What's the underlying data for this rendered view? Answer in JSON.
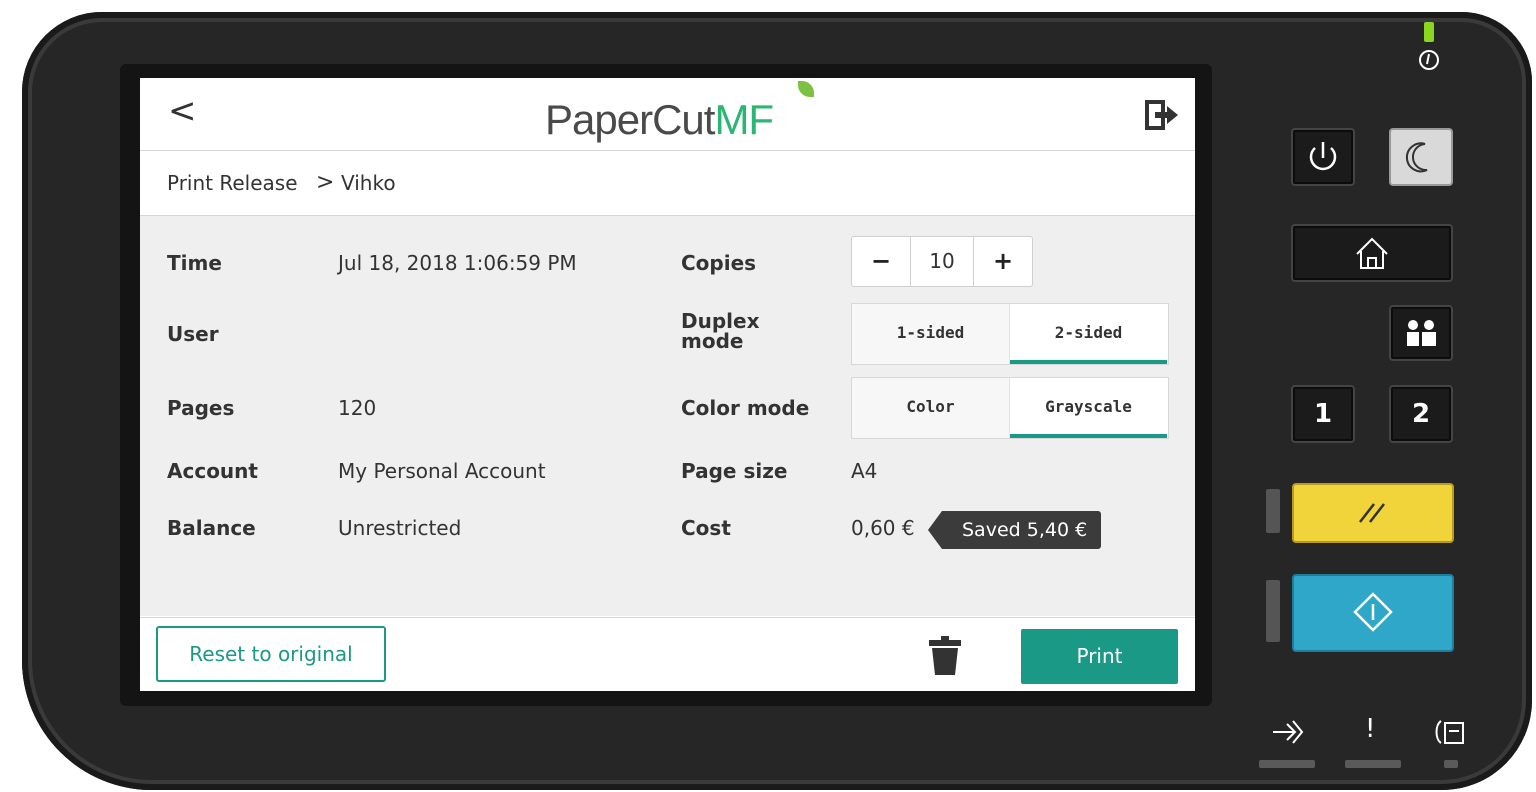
{
  "header": {
    "back_glyph": "<",
    "logo_main": "PaperCut",
    "logo_suffix": "MF"
  },
  "breadcrumb": {
    "parent": "Print Release",
    "separator": ">",
    "current": "Vihko"
  },
  "job": {
    "time_label": "Time",
    "time_value": "Jul 18, 2018 1:06:59 PM",
    "user_label": "User",
    "user_value": "",
    "pages_label": "Pages",
    "pages_value": "120",
    "account_label": "Account",
    "account_value": "My Personal Account",
    "balance_label": "Balance",
    "balance_value": "Unrestricted"
  },
  "settings": {
    "copies_label": "Copies",
    "copies_minus": "−",
    "copies_value": "10",
    "copies_plus": "+",
    "duplex_label_line1": "Duplex",
    "duplex_label_line2": "mode",
    "duplex_options": [
      "1-sided",
      "2-sided"
    ],
    "duplex_selected": "2-sided",
    "color_label": "Color mode",
    "color_options": [
      "Color",
      "Grayscale"
    ],
    "color_selected": "Grayscale",
    "page_size_label": "Page size",
    "page_size_value": "A4",
    "cost_label": "Cost",
    "cost_value": "0,60 €",
    "saved_badge": "Saved 5,40 €"
  },
  "actions": {
    "reset_label": "Reset to original",
    "print_label": "Print"
  },
  "hardware": {
    "button_1": "1",
    "button_2": "2",
    "alert_glyph": "!"
  },
  "colors": {
    "accent": "#1a9987",
    "logo_green": "#2bb673",
    "reset_key": "#f0d43a",
    "start_key": "#2ea7c9"
  }
}
